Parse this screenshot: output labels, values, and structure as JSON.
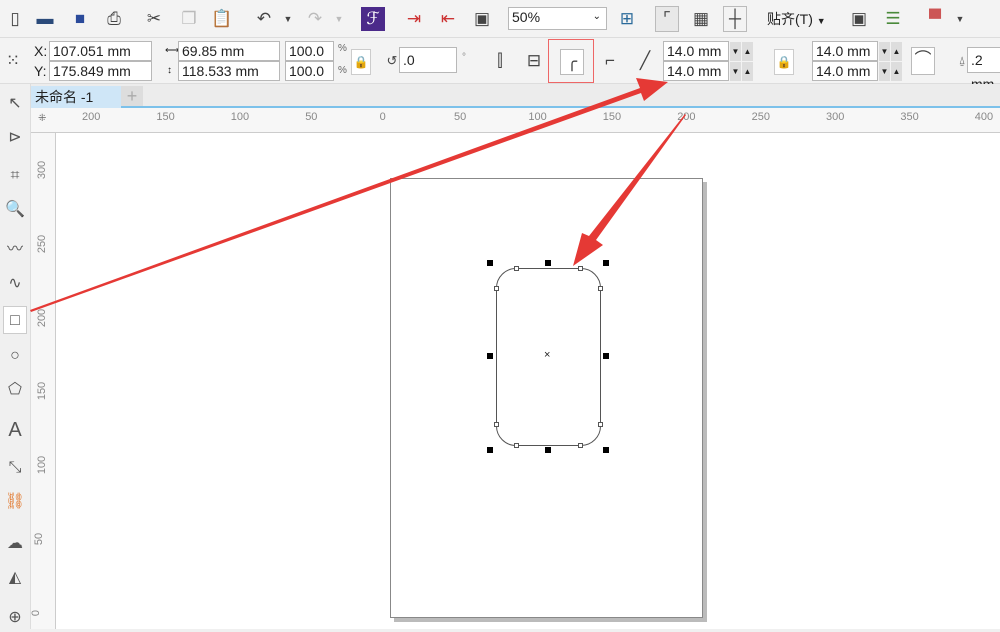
{
  "toolbar": {
    "zoom": "50%",
    "snap_label": "贴齐(T)",
    "icons": [
      "new-icon",
      "open-icon",
      "save-icon",
      "print-icon",
      "cut-icon",
      "copy-icon",
      "paste-icon",
      "undo-icon",
      "redo-icon",
      "launcher-icon",
      "import-icon",
      "export-icon",
      "publish-pdf-icon",
      "full-screen-icon",
      "rulers-icon",
      "grid-icon",
      "guidelines-icon",
      "options-icon",
      "checklist-icon",
      "application-launcher-icon"
    ]
  },
  "props": {
    "x": "107.051 mm",
    "y": "175.849 mm",
    "x_label": "X:",
    "y_label": "Y:",
    "width": "69.85 mm",
    "height": "118.533 mm",
    "scale_x": "100.0",
    "scale_y": "100.0",
    "pct": "%",
    "rotation": ".0",
    "deg": "°",
    "corner_tl": "14.0 mm",
    "corner_bl": "14.0 mm",
    "corner_tr": "14.0 mm",
    "corner_br": "14.0 mm",
    "outline": ".2 mm"
  },
  "doc": {
    "tab": "未命名 -1",
    "add": "+"
  },
  "ruler": {
    "h": [
      "200",
      "150",
      "100",
      "50",
      "0",
      "50",
      "100",
      "150",
      "200",
      "250",
      "300",
      "350",
      "400"
    ],
    "v": [
      "300",
      "250",
      "200",
      "150",
      "100",
      "50",
      "0"
    ]
  },
  "annotation_color": "#e53935"
}
